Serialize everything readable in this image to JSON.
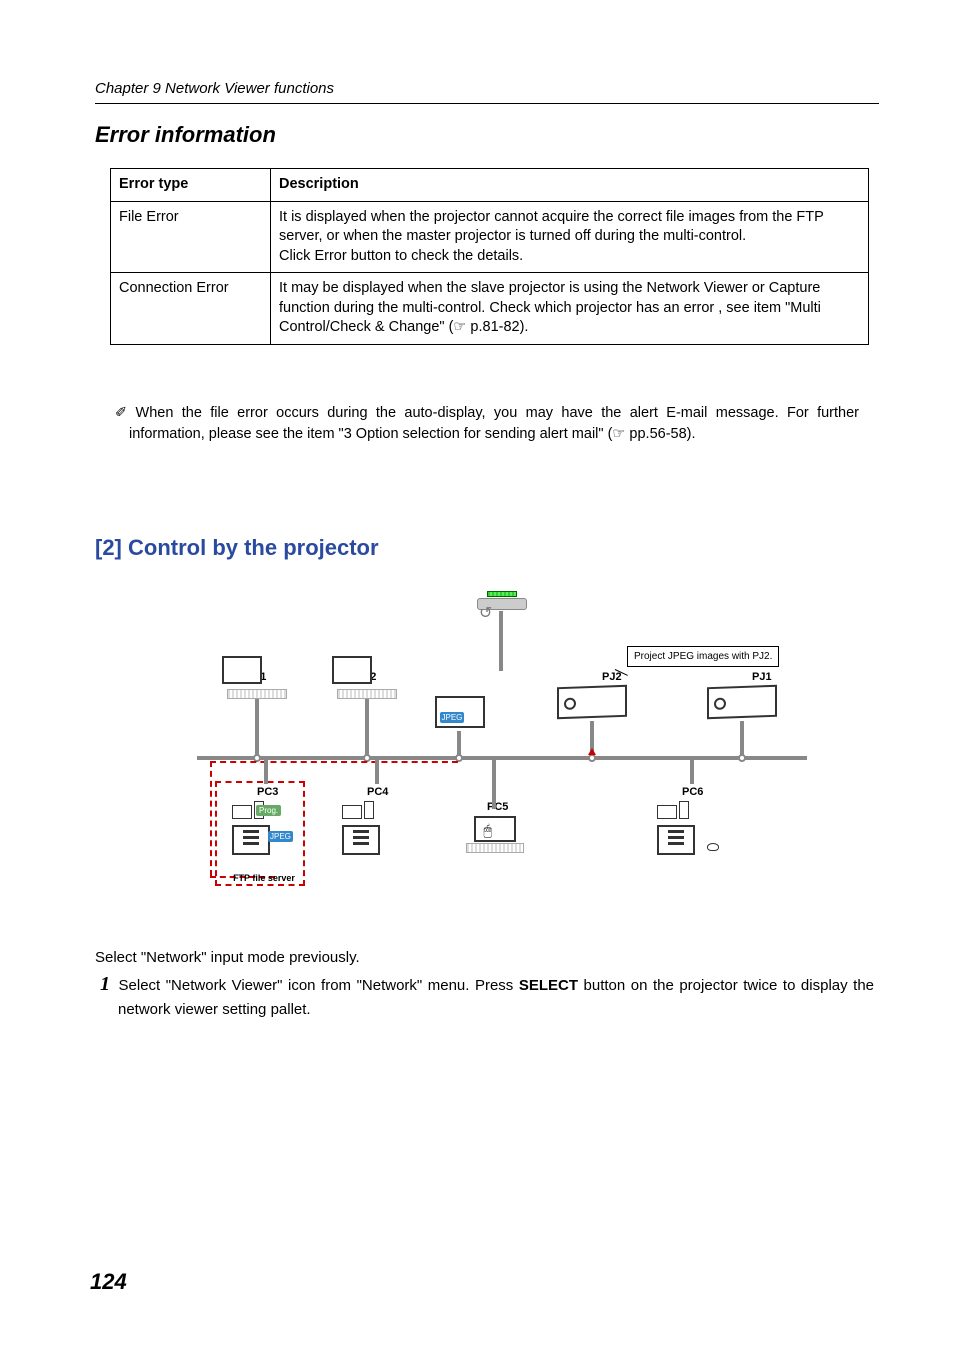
{
  "chapter": "Chapter 9 Network Viewer functions",
  "heading1": "Error information",
  "table": {
    "headers": {
      "col1": "Error type",
      "col2": "Description"
    },
    "rows": [
      {
        "type": "File Error",
        "desc": "It is displayed when the projector cannot acquire the correct file images from the FTP server, or when the master projector is turned off during the multi-control.\nClick Error button to check the details."
      },
      {
        "type": "Connection Error",
        "desc": "It may be displayed when the slave projector is using the Network Viewer or Capture function during the multi-control. Check which projector has an error , see item \"Multi Control/Check & Change\" (☞ p.81-82)."
      }
    ]
  },
  "note": "✐ When the file error occurs during the auto-display, you may have the alert E-mail message. For further information, please see the item \"3 Option selection for sending alert mail\" (☞ pp.56-58).",
  "heading2": "[2] Control by the projector",
  "diagram": {
    "pc1": "PC1",
    "pc2": "PC2",
    "pc3": "PC3",
    "pc4": "PC4",
    "pc5": "PC5",
    "pc6": "PC6",
    "pj1": "PJ1",
    "pj2": "PJ2",
    "ftp": "FTP file server",
    "callout": "Project JPEG images with PJ2.",
    "jpeg": "JPEG",
    "prog": "Prog."
  },
  "desc_pre": "Select \"Network\"  input mode previously.",
  "step1_num": "1",
  "step1_a": " Select \"Network Viewer\" icon from \"Network\" menu. Press ",
  "step1_b": "SELECT",
  "step1_c": " button on the projector twice to display the network viewer setting pallet.",
  "pagenum": "124"
}
